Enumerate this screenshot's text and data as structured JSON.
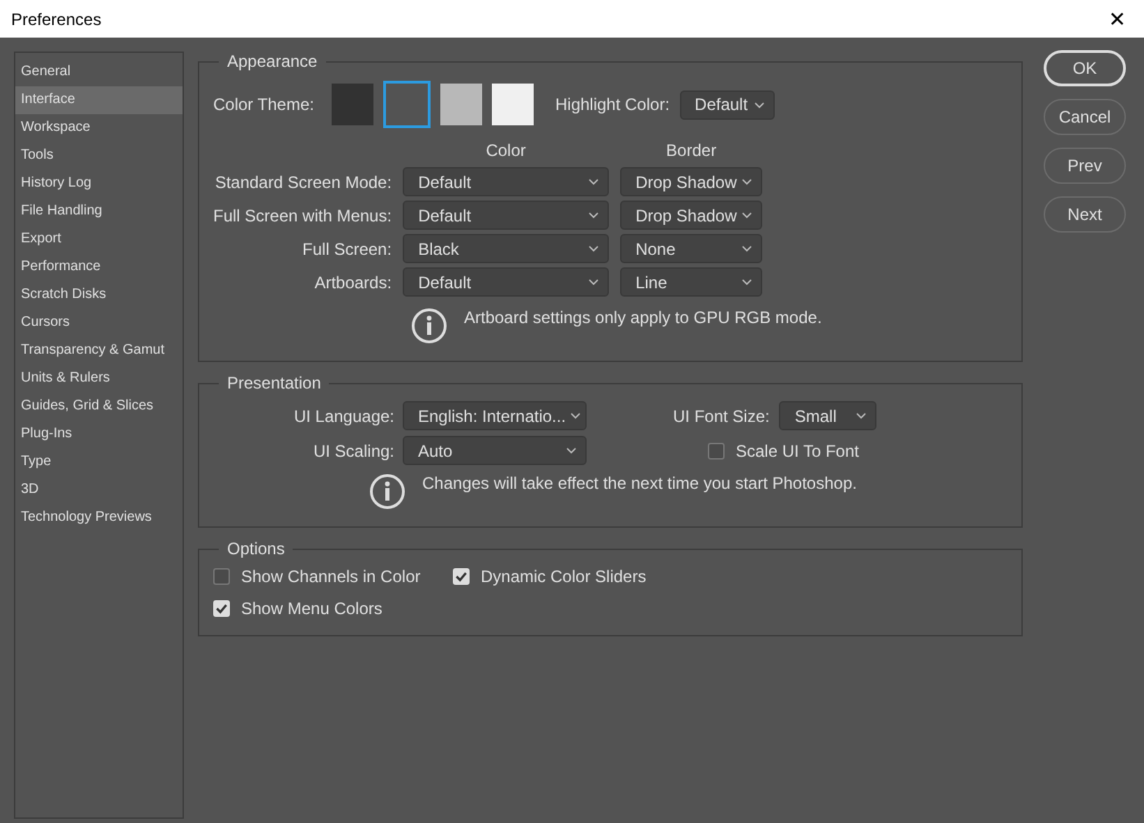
{
  "window": {
    "title": "Preferences",
    "close": "✕"
  },
  "sidebar": {
    "items": [
      {
        "label": "General",
        "selected": false
      },
      {
        "label": "Interface",
        "selected": true
      },
      {
        "label": "Workspace",
        "selected": false
      },
      {
        "label": "Tools",
        "selected": false
      },
      {
        "label": "History Log",
        "selected": false
      },
      {
        "label": "File Handling",
        "selected": false
      },
      {
        "label": "Export",
        "selected": false
      },
      {
        "label": "Performance",
        "selected": false
      },
      {
        "label": "Scratch Disks",
        "selected": false
      },
      {
        "label": "Cursors",
        "selected": false
      },
      {
        "label": "Transparency & Gamut",
        "selected": false
      },
      {
        "label": "Units & Rulers",
        "selected": false
      },
      {
        "label": "Guides, Grid & Slices",
        "selected": false
      },
      {
        "label": "Plug-Ins",
        "selected": false
      },
      {
        "label": "Type",
        "selected": false
      },
      {
        "label": "3D",
        "selected": false
      },
      {
        "label": "Technology Previews",
        "selected": false
      }
    ]
  },
  "appearance": {
    "title": "Appearance",
    "color_theme_label": "Color Theme:",
    "themes": [
      {
        "color": "#323232",
        "selected": false
      },
      {
        "color": "#535353",
        "selected": true
      },
      {
        "color": "#b8b8b8",
        "selected": false
      },
      {
        "color": "#f0f0f0",
        "selected": false
      }
    ],
    "highlight_label": "Highlight Color:",
    "highlight_value": "Default",
    "column_headers": [
      "Color",
      "Border"
    ],
    "rows": [
      {
        "label": "Standard Screen Mode:",
        "color_mode": "Default",
        "border": "Drop Shadow"
      },
      {
        "label": "Full Screen with Menus:",
        "color_mode": "Default",
        "border": "Drop Shadow"
      },
      {
        "label": "Full Screen:",
        "color_mode": "Black",
        "border": "None"
      },
      {
        "label": "Artboards:",
        "color_mode": "Default",
        "border": "Line"
      }
    ],
    "note": "Artboard settings only apply to GPU RGB mode."
  },
  "presentation": {
    "title": "Presentation",
    "ui_language_label": "UI Language:",
    "ui_language": "English: Internatio...",
    "ui_font_size_label": "UI Font Size:",
    "ui_font_size": "Small",
    "ui_scaling_label": "UI Scaling:",
    "ui_scaling": "Auto",
    "scale_ui_to_font": {
      "label": "Scale UI To Font",
      "checked": false
    },
    "note": "Changes will take effect the next time you start Photoshop."
  },
  "options": {
    "title": "Options",
    "checkboxes": [
      {
        "label": "Show Channels in Color",
        "checked": false
      },
      {
        "label": "Dynamic Color Sliders",
        "checked": true
      },
      {
        "label": "Show Menu Colors",
        "checked": true
      }
    ]
  },
  "buttons": [
    {
      "label": "OK",
      "default": true
    },
    {
      "label": "Cancel",
      "default": false
    },
    {
      "label": "Prev",
      "default": false
    },
    {
      "label": "Next",
      "default": false
    }
  ]
}
